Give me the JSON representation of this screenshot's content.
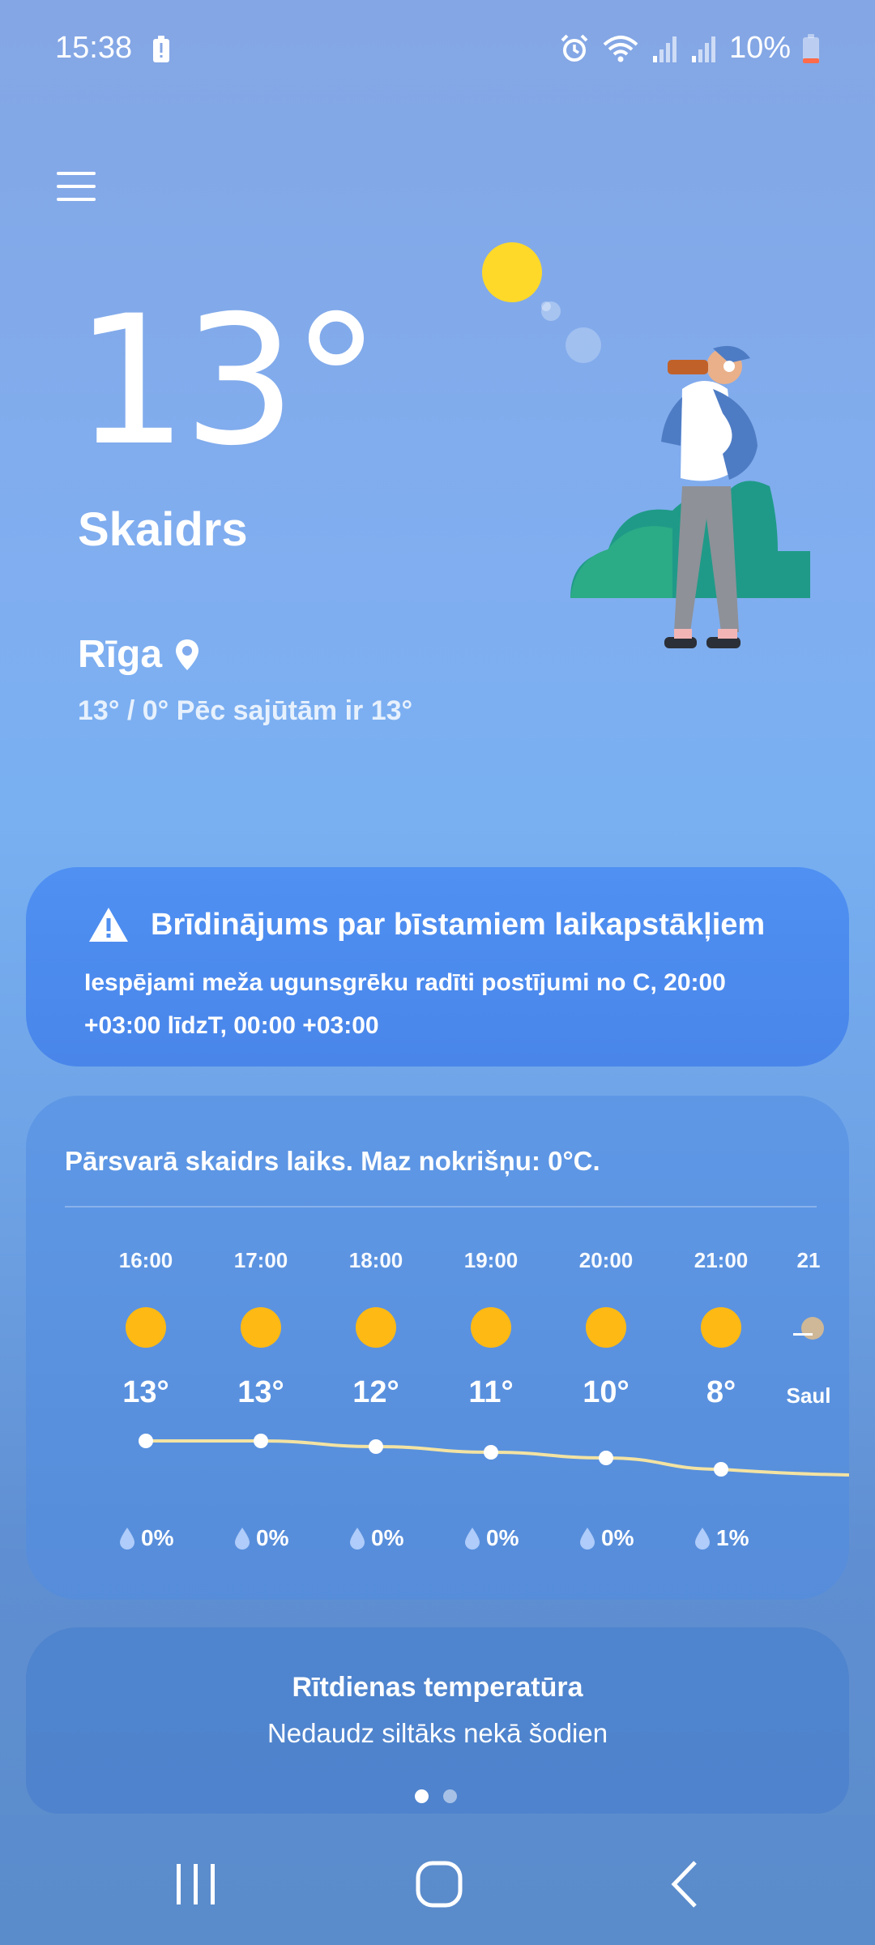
{
  "status_bar": {
    "time": "15:38",
    "battery_percent": "10%",
    "icons": [
      "battery-saver-icon",
      "alarm-icon",
      "wifi-icon",
      "signal-icon",
      "signal-icon",
      "battery-icon"
    ]
  },
  "menu": {
    "icon": "hamburger-menu-icon"
  },
  "current": {
    "temperature": "13°",
    "condition": "Skaidrs",
    "city": "Rīga",
    "minmax_feels": "13° / 0° Pēc sajūtām ir 13°"
  },
  "alert": {
    "title": "Brīdinājums par bīstamiem laikapstākļiem",
    "text": "Iespējami meža ugunsgrēku radīti postījumi no C, 20:00 +03:00 līdzT, 00:00 +03:00",
    "icon": "warning-icon"
  },
  "hourly": {
    "summary": "Pārsvarā skaidrs laiks. Maz nokrišņu: 0°C.",
    "hours": [
      {
        "time": "16:00",
        "temp": "13°",
        "rain": "0%",
        "temp_value": 13
      },
      {
        "time": "17:00",
        "temp": "13°",
        "rain": "0%",
        "temp_value": 13
      },
      {
        "time": "18:00",
        "temp": "12°",
        "rain": "0%",
        "temp_value": 12
      },
      {
        "time": "19:00",
        "temp": "11°",
        "rain": "0%",
        "temp_value": 11
      },
      {
        "time": "20:00",
        "temp": "10°",
        "rain": "0%",
        "temp_value": 10
      },
      {
        "time": "21:00",
        "temp": "8°",
        "rain": "1%",
        "temp_value": 8
      }
    ],
    "partial_time": "21",
    "partial_label": "Saul"
  },
  "tomorrow": {
    "title": "Rītdienas temperatūra",
    "subtitle": "Nedaudz siltāks nekā šodien",
    "page_count": 2,
    "active_page": 1
  },
  "colors": {
    "sun": "#ffb914",
    "alert_bg": "#4f90f2",
    "curve": "#f5e6a6"
  }
}
